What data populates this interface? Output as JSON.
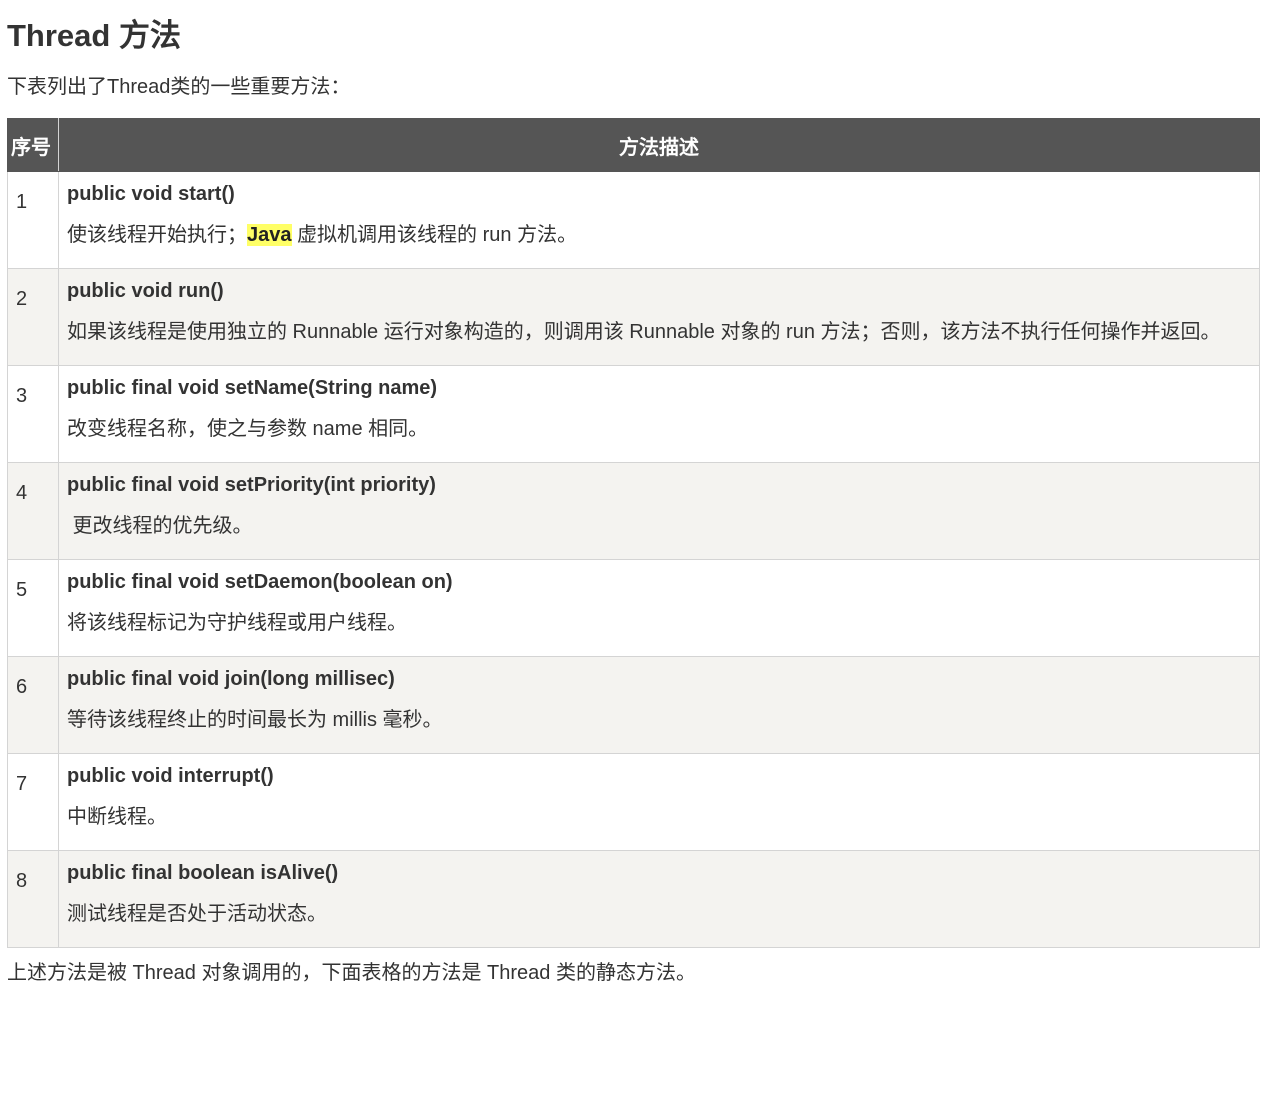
{
  "title": "Thread 方法",
  "intro": "下表列出了Thread类的一些重要方法：",
  "table": {
    "headers": [
      "序号",
      "方法描述"
    ],
    "rows": [
      {
        "num": "1",
        "signature": "public void start()",
        "desc_before": "使该线程开始执行；",
        "desc_highlight": "Java",
        "desc_after": " 虚拟机调用该线程的 run 方法。"
      },
      {
        "num": "2",
        "signature": "public void run()",
        "desc_before": "如果该线程是使用独立的 Runnable 运行对象构造的，则调用该 Runnable 对象的 run 方法；否则，该方法不执行任何操作并返回。",
        "desc_highlight": "",
        "desc_after": ""
      },
      {
        "num": "3",
        "signature": "public final void setName(String name)",
        "desc_before": "改变线程名称，使之与参数 name 相同。",
        "desc_highlight": "",
        "desc_after": ""
      },
      {
        "num": "4",
        "signature": "public final void setPriority(int priority)",
        "desc_before": " 更改线程的优先级。",
        "desc_highlight": "",
        "desc_after": ""
      },
      {
        "num": "5",
        "signature": "public final void setDaemon(boolean on)",
        "desc_before": "将该线程标记为守护线程或用户线程。",
        "desc_highlight": "",
        "desc_after": ""
      },
      {
        "num": "6",
        "signature": "public final void join(long millisec)",
        "desc_before": "等待该线程终止的时间最长为 millis 毫秒。",
        "desc_highlight": "",
        "desc_after": ""
      },
      {
        "num": "7",
        "signature": "public void interrupt()",
        "desc_before": "中断线程。",
        "desc_highlight": "",
        "desc_after": ""
      },
      {
        "num": "8",
        "signature": "public final boolean isAlive()",
        "desc_before": "测试线程是否处于活动状态。",
        "desc_highlight": "",
        "desc_after": ""
      }
    ]
  },
  "outro": "上述方法是被 Thread 对象调用的，下面表格的方法是 Thread 类的静态方法。",
  "colors": {
    "header_bg": "#555555",
    "even_row_bg": "#f4f3f0",
    "highlight_bg": "#ffff66"
  }
}
